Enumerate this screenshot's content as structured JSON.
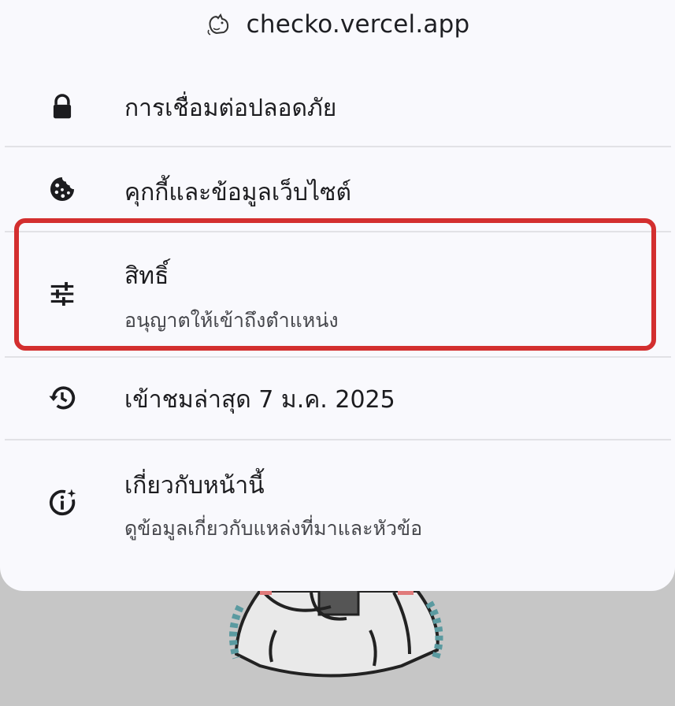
{
  "header": {
    "domain": "checko.vercel.app",
    "favicon": "cat-favicon-icon"
  },
  "menu": {
    "items": [
      {
        "title": "การเชื่อมต่อปลอดภัย",
        "icon": "lock-icon"
      },
      {
        "title": "คุกกี้และข้อมูลเว็บไซต์",
        "icon": "cookie-icon"
      },
      {
        "title": "สิทธิ์",
        "subtitle": "อนุญาตให้เข้าถึงตำแหน่ง",
        "icon": "tune-icon",
        "highlighted": true
      },
      {
        "title": "เข้าชมล่าสุด 7 ม.ค. 2025",
        "icon": "history-icon"
      },
      {
        "title": "เกี่ยวกับหน้านี้",
        "subtitle": "ดูข้อมูลเกี่ยวกับแหล่งที่มาและหัวข้อ",
        "icon": "info-sparkle-icon"
      }
    ]
  },
  "colors": {
    "sheet_background": "#f9f9fd",
    "page_background": "#c6c6c6",
    "highlight_border": "#d32f2f",
    "text_primary": "#1c1c1f",
    "text_secondary": "#46474c"
  }
}
